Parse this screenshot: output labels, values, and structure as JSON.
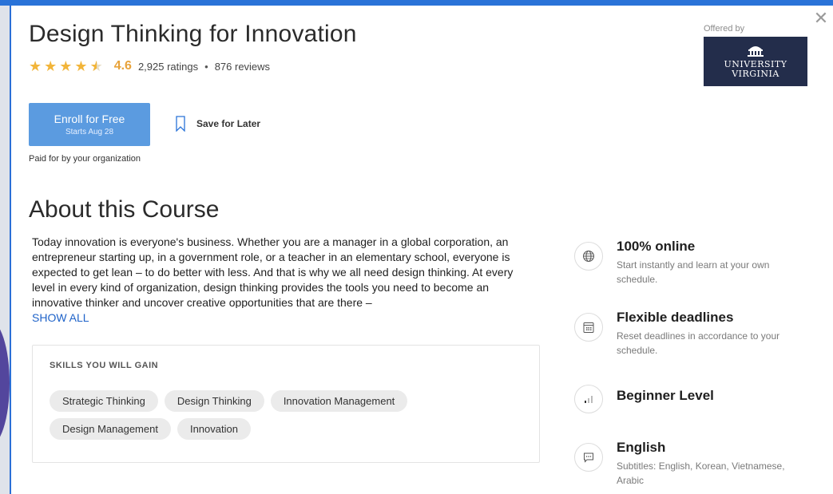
{
  "course": {
    "title": "Design Thinking for Innovation",
    "rating_value": "4.6",
    "ratings_count": "2,925 ratings",
    "bullet": "•",
    "reviews_count": "876 reviews",
    "stars": 4.5
  },
  "offered": {
    "label": "Offered by",
    "logo_text_line1": "UNIVERSITY",
    "logo_text_line2": "VIRGINIA"
  },
  "enroll": {
    "label": "Enroll for Free",
    "sublabel": "Starts Aug 28"
  },
  "save_later": "Save for Later",
  "paid_note": "Paid for by your organization",
  "about": {
    "heading": "About this Course",
    "text": "Today innovation is everyone's business. Whether you are a manager in a global corporation, an entrepreneur starting up, in a government role, or a teacher in an elementary school, everyone is expected to get lean – to do better with less. And that is why we all need design thinking. At every level in every kind of organization, design thinking provides the tools you need to become an innovative thinker and uncover creative opportunities that are there –",
    "show_all": "SHOW ALL"
  },
  "skills": {
    "heading": "SKILLS YOU WILL GAIN",
    "items": [
      "Strategic Thinking",
      "Design Thinking",
      "Innovation Management",
      "Design Management",
      "Innovation"
    ]
  },
  "features": [
    {
      "icon": "globe-icon",
      "title": "100% online",
      "desc": "Start instantly and learn at your own schedule."
    },
    {
      "icon": "calendar-icon",
      "title": "Flexible deadlines",
      "desc": "Reset deadlines in accordance to your schedule."
    },
    {
      "icon": "level-bars-icon",
      "title": "Beginner Level",
      "desc": ""
    },
    {
      "icon": "chat-bubble-icon",
      "title": "English",
      "desc": "Subtitles: English, Korean, Vietnamese, Arabic"
    }
  ],
  "colors": {
    "accent": "#5b9be0",
    "star": "#f2b53a",
    "link": "#1f63c9",
    "logo_bg": "#232d4b"
  }
}
